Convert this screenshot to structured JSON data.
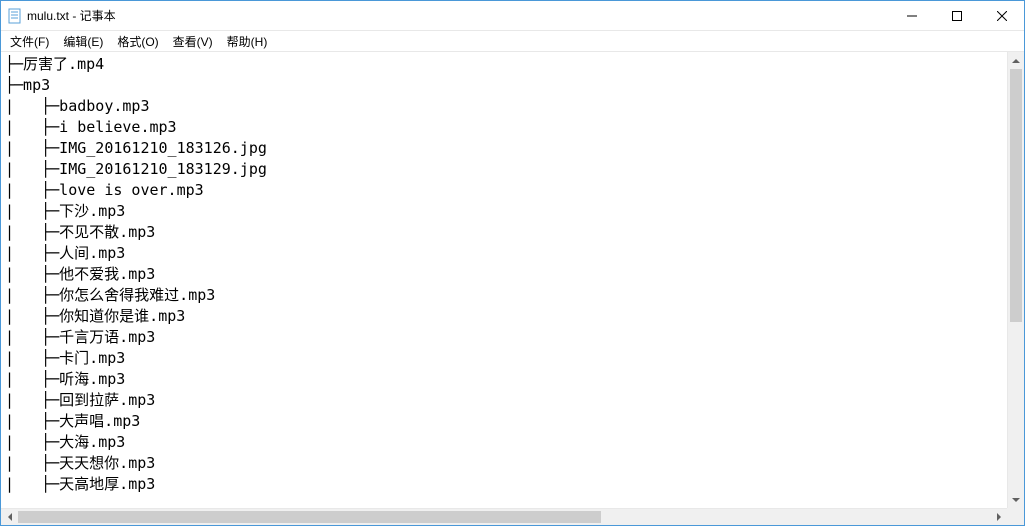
{
  "titlebar": {
    "title": "mulu.txt - 记事本"
  },
  "menu": {
    "file": "文件(F)",
    "edit": "编辑(E)",
    "format": "格式(O)",
    "view": "查看(V)",
    "help": "帮助(H)"
  },
  "lines": [
    "├─厉害了.mp4",
    "├─mp3",
    "|   ├─badboy.mp3",
    "|   ├─i believe.mp3",
    "|   ├─IMG_20161210_183126.jpg",
    "|   ├─IMG_20161210_183129.jpg",
    "|   ├─love is over.mp3",
    "|   ├─下沙.mp3",
    "|   ├─不见不散.mp3",
    "|   ├─人间.mp3",
    "|   ├─他不爱我.mp3",
    "|   ├─你怎么舍得我难过.mp3",
    "|   ├─你知道你是谁.mp3",
    "|   ├─千言万语.mp3",
    "|   ├─卡门.mp3",
    "|   ├─听海.mp3",
    "|   ├─回到拉萨.mp3",
    "|   ├─大声唱.mp3",
    "|   ├─大海.mp3",
    "|   ├─天天想你.mp3",
    "|   ├─天高地厚.mp3"
  ]
}
